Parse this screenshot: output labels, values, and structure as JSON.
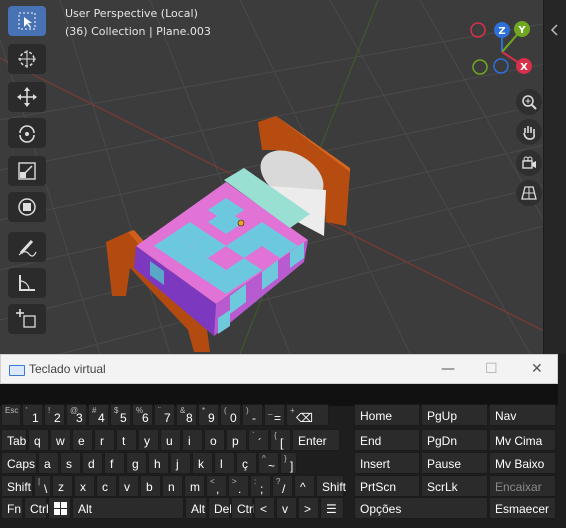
{
  "viewport": {
    "header_line1": "User Perspective (Local)",
    "header_line2": "(36) Collection | Plane.003",
    "toolbar": [
      {
        "name": "select-box-tool",
        "icon": "cursor-select-icon",
        "active": true
      },
      {
        "name": "cursor-tool",
        "icon": "crosshair-icon",
        "active": false
      },
      {
        "name": "move-tool",
        "icon": "move-arrows-icon",
        "active": false
      },
      {
        "name": "rotate-tool",
        "icon": "rotate-icon",
        "active": false
      },
      {
        "name": "scale-tool",
        "icon": "scale-icon",
        "active": false
      },
      {
        "name": "transform-tool",
        "icon": "transform-icon",
        "active": false
      },
      {
        "name": "annotate-tool",
        "icon": "pencil-icon",
        "active": false
      },
      {
        "name": "measure-tool",
        "icon": "ruler-angle-icon",
        "active": false
      },
      {
        "name": "add-cube-tool",
        "icon": "add-cube-icon",
        "active": false
      }
    ],
    "gizmo": {
      "z": "Z",
      "y": "Y",
      "x": "X",
      "z_color": "#2e6fd8",
      "y_color": "#6fa820",
      "x_color": "#d8304a"
    },
    "nav_buttons": [
      "zoom-icon",
      "hand-pan-icon",
      "camera-icon",
      "grid-view-icon"
    ]
  },
  "osk": {
    "title": "Teclado virtual",
    "minimize": "—",
    "maximize": "☐",
    "close": "✕",
    "rows": [
      [
        {
          "main": "",
          "sub": "Esc",
          "w": 20
        },
        {
          "main": "1",
          "sub": "'",
          "w": 21
        },
        {
          "main": "2",
          "sub": "!",
          "w": 21
        },
        {
          "main": "3",
          "sub": "@",
          "w": 21
        },
        {
          "main": "4",
          "sub": "#",
          "w": 21
        },
        {
          "main": "5",
          "sub": "$",
          "w": 21
        },
        {
          "main": "6",
          "sub": "%",
          "w": 21
        },
        {
          "main": "7",
          "sub": "¨",
          "w": 21
        },
        {
          "main": "8",
          "sub": "&",
          "w": 21
        },
        {
          "main": "9",
          "sub": "*",
          "w": 21
        },
        {
          "main": "0",
          "sub": "(",
          "w": 21
        },
        {
          "main": "-",
          "sub": ")",
          "w": 21
        },
        {
          "main": "=",
          "sub": "_",
          "w": 21
        },
        {
          "main": "⌫",
          "sub": "+",
          "w": 43
        }
      ],
      [
        {
          "main": "Tab",
          "sub": "",
          "w": 26
        },
        {
          "main": "q",
          "w": 21
        },
        {
          "main": "w",
          "w": 21
        },
        {
          "main": "e",
          "w": 21
        },
        {
          "main": "r",
          "w": 21
        },
        {
          "main": "t",
          "w": 21
        },
        {
          "main": "y",
          "w": 21
        },
        {
          "main": "u",
          "w": 21
        },
        {
          "main": "i",
          "w": 21
        },
        {
          "main": "o",
          "w": 21
        },
        {
          "main": "p",
          "w": 21
        },
        {
          "main": "´",
          "sub": "`",
          "w": 21
        },
        {
          "main": "[",
          "sub": "{",
          "w": 21
        },
        {
          "main": "Enter",
          "w": 48
        }
      ],
      [
        {
          "main": "Caps",
          "w": 36
        },
        {
          "main": "a",
          "w": 21
        },
        {
          "main": "s",
          "w": 21
        },
        {
          "main": "d",
          "w": 21
        },
        {
          "main": "f",
          "w": 21
        },
        {
          "main": "g",
          "w": 21
        },
        {
          "main": "h",
          "w": 21
        },
        {
          "main": "j",
          "w": 21
        },
        {
          "main": "k",
          "w": 21
        },
        {
          "main": "l",
          "w": 21
        },
        {
          "main": "ç",
          "w": 21
        },
        {
          "main": "~",
          "sub": "^",
          "w": 21
        },
        {
          "main": "]",
          "sub": "}",
          "w": 17
        }
      ],
      [
        {
          "main": "Shift",
          "w": 32
        },
        {
          "main": "\\",
          "sub": "|",
          "w": 17
        },
        {
          "main": "z",
          "w": 21
        },
        {
          "main": "x",
          "w": 21
        },
        {
          "main": "c",
          "w": 21
        },
        {
          "main": "v",
          "w": 21
        },
        {
          "main": "b",
          "w": 21
        },
        {
          "main": "n",
          "w": 21
        },
        {
          "main": "m",
          "w": 21
        },
        {
          "main": ",",
          "sub": "<",
          "w": 21
        },
        {
          "main": ".",
          "sub": ">",
          "w": 21
        },
        {
          "main": ";",
          "sub": ":",
          "w": 21
        },
        {
          "main": "/",
          "sub": "?",
          "w": 21
        },
        {
          "main": "^",
          "w": 21
        },
        {
          "main": "Shift",
          "w": 28
        }
      ],
      [
        {
          "main": "Fn",
          "w": 22
        },
        {
          "main": "Ctrl",
          "w": 23
        },
        {
          "main": "win-logo-icon",
          "w": 23
        },
        {
          "main": "Alt",
          "w": 112
        },
        {
          "main": "Alt",
          "w": 22
        },
        {
          "main": "Del",
          "w": 22
        },
        {
          "main": "Ctrl",
          "w": 22
        },
        {
          "main": "<",
          "w": 21
        },
        {
          "main": "v",
          "w": 21
        },
        {
          "main": ">",
          "w": 21
        },
        {
          "main": "☰",
          "w": 24
        }
      ]
    ],
    "nav_keys": [
      [
        "Home",
        "PgUp",
        "Nav"
      ],
      [
        "End",
        "PgDn",
        "Mv Cima"
      ],
      [
        "Insert",
        "Pause",
        "Mv Baixo"
      ],
      [
        "PrtScn",
        "ScrLk",
        "Encaixar"
      ],
      [
        "Opções",
        "",
        "Esmaecer"
      ]
    ]
  }
}
